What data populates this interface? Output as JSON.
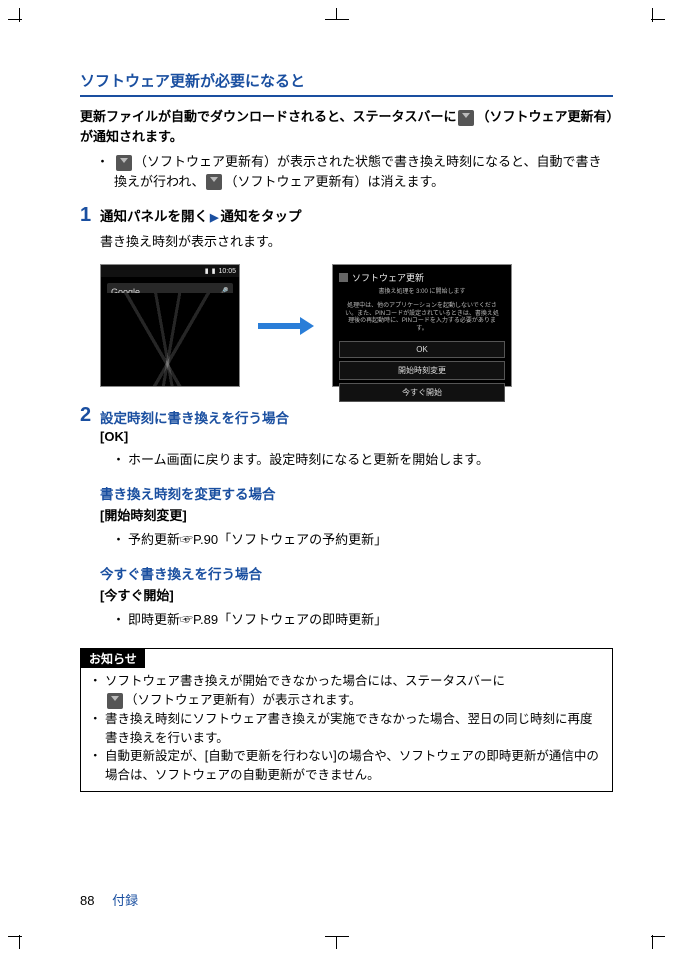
{
  "section_title": "ソフトウェア更新が必要になると",
  "intro": {
    "line1_a": "更新ファイルが自動でダウンロードされると、ステータスバーに",
    "line1_b": "（ソフトウェア更新有）が通知されます。",
    "bullet1_a": "（ソフトウェア更新有）が表示された状態で書き換え時刻になると、自動で書き換えが行われ、",
    "bullet1_b": "（ソフトウェア更新有）は消えます。"
  },
  "step1": {
    "num": "1",
    "title_a": "通知パネルを開く",
    "title_b": "通知をタップ",
    "desc": "書き換え時刻が表示されます。"
  },
  "fig_lock": {
    "time": "10:05",
    "search": "Google",
    "mic": "🎤"
  },
  "fig_dialog": {
    "title": "ソフトウェア更新",
    "msg1": "書換え処理を 3:00 に開始します",
    "msg2": "処理中は、他のアプリケーションを起動しないでください。また、PINコードが設定されているときは、書換え処理後の再起動時に、PINコードを入力する必要があります。",
    "btn_ok": "OK",
    "btn_change": "開始時刻変更",
    "btn_now": "今すぐ開始"
  },
  "step2": {
    "num": "2",
    "h1": "設定時刻に書き換えを行う場合",
    "b1": "[OK]",
    "li1": "ホーム画面に戻ります。設定時刻になると更新を開始します。",
    "h2": "書き換え時刻を変更する場合",
    "b2": "[開始時刻変更]",
    "li2": "予約更新☞P.90「ソフトウェアの予約更新」",
    "h3": "今すぐ書き換えを行う場合",
    "b3": "[今すぐ開始]",
    "li3": "即時更新☞P.89「ソフトウェアの即時更新」"
  },
  "notice": {
    "label": "お知らせ",
    "li1_a": "ソフトウェア書き換えが開始できなかった場合には、ステータスバーに",
    "li1_b": "（ソフトウェア更新有）が表示されます。",
    "li2": "書き換え時刻にソフトウェア書き換えが実施できなかった場合、翌日の同じ時刻に再度書き換えを行います。",
    "li3": "自動更新設定が、[自動で更新を行わない]の場合や、ソフトウェアの即時更新が通信中の場合は、ソフトウェアの自動更新ができません。"
  },
  "footer": {
    "page": "88",
    "label": "付録"
  }
}
